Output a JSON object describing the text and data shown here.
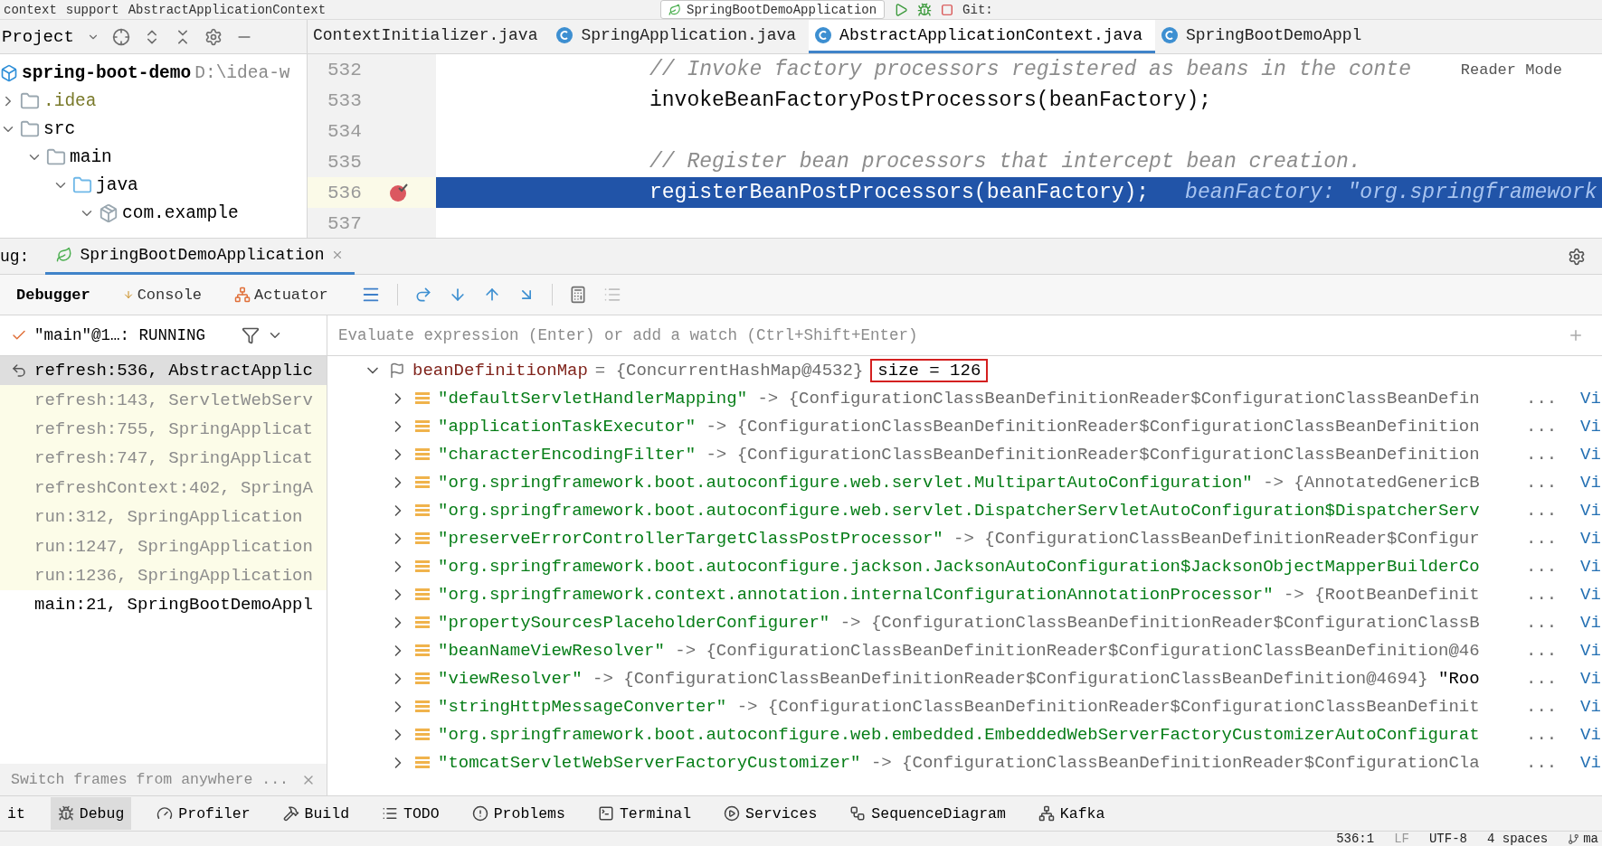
{
  "breadcrumbs": [
    "context",
    "support",
    "AbstractApplicationContext"
  ],
  "run_config": "SpringBootDemoApplication",
  "vcs_label": "Git:",
  "project_panel": {
    "title": "Project",
    "tree": [
      {
        "name": "spring-boot-demo",
        "kind": "module",
        "path": "D:\\idea-w",
        "ignored": false,
        "children": [
          {
            "name": ".idea",
            "kind": "folder",
            "expanded": false,
            "ignored": true
          },
          {
            "name": "src",
            "kind": "folder",
            "expanded": true,
            "ignored": false,
            "children": [
              {
                "name": "main",
                "kind": "folder",
                "expanded": true,
                "ignored": false,
                "children": [
                  {
                    "name": "java",
                    "kind": "source",
                    "expanded": true,
                    "ignored": false,
                    "children": [
                      {
                        "name": "com.example",
                        "kind": "package",
                        "expanded": true,
                        "ignored": false
                      }
                    ]
                  }
                ]
              }
            ]
          }
        ]
      }
    ]
  },
  "editor_tabs": [
    {
      "label": "ContextInitializer.java",
      "selected": false,
      "icon": false
    },
    {
      "label": "SpringApplication.java",
      "selected": false,
      "icon": true
    },
    {
      "label": "AbstractApplicationContext.java",
      "selected": true,
      "icon": true
    },
    {
      "label": "SpringBootDemoAppl",
      "selected": false,
      "icon": true
    }
  ],
  "editor": {
    "reader_mode": "Reader Mode",
    "lines": [
      {
        "number": "532",
        "kind": "comment",
        "text": "// Invoke factory processors registered as beans in the conte",
        "breakpoint": false,
        "current": false
      },
      {
        "number": "533",
        "kind": "code",
        "text": "invokeBeanFactoryPostProcessors(beanFactory);",
        "breakpoint": false,
        "current": false
      },
      {
        "number": "534",
        "kind": "blank",
        "breakpoint": false,
        "current": false
      },
      {
        "number": "535",
        "kind": "comment",
        "text": "// Register bean processors that intercept bean creation.",
        "breakpoint": false,
        "current": false
      },
      {
        "number": "536",
        "kind": "code",
        "text": "registerBeanPostProcessors(beanFactory);",
        "hint": "beanFactory: \"org.springframework",
        "breakpoint": true,
        "current": true
      },
      {
        "number": "537",
        "kind": "blank",
        "breakpoint": false,
        "current": false
      }
    ]
  },
  "debug": {
    "label": "ug:",
    "session_tab": "SpringBootDemoApplication",
    "tabs": [
      {
        "label": "Debugger",
        "selected": true
      },
      {
        "label": "Console",
        "selected": false
      },
      {
        "label": "Actuator",
        "selected": false
      }
    ],
    "thread": "\"main\"@1…: RUNNING",
    "evaluate_placeholder": "Evaluate expression (Enter) or add a watch (Ctrl+Shift+Enter)",
    "frames": [
      {
        "text": "refresh:536, AbstractApplic",
        "kind": "current",
        "selected": true
      },
      {
        "text": "refresh:143, ServletWebServ",
        "kind": "library",
        "selected": false
      },
      {
        "text": "refresh:755, SpringApplicat",
        "kind": "library",
        "selected": false
      },
      {
        "text": "refresh:747, SpringApplicat",
        "kind": "library",
        "selected": false
      },
      {
        "text": "refreshContext:402, SpringA",
        "kind": "library",
        "selected": false
      },
      {
        "text": "run:312, SpringApplication",
        "kind": "library",
        "selected": false
      },
      {
        "text": "run:1247, SpringApplication",
        "kind": "library",
        "selected": false
      },
      {
        "text": "run:1236, SpringApplication",
        "kind": "library",
        "selected": false
      },
      {
        "text": "main:21, SpringBootDemoAppl",
        "kind": "user",
        "selected": false
      }
    ],
    "frames_hint": "Switch frames from anywhere ...",
    "variable": {
      "name": "beanDefinitionMap",
      "value": "= {ConcurrentHashMap@4532}",
      "size": "size = 126",
      "boxed": true,
      "expanded": true,
      "entries": [
        {
          "key": "\"defaultServletHandlerMapping\"",
          "value": "-> {ConfigurationClassBeanDefinitionReader$ConfigurationClassBeanDefin",
          "more": "...",
          "link": "Vi"
        },
        {
          "key": "\"applicationTaskExecutor\"",
          "value": "-> {ConfigurationClassBeanDefinitionReader$ConfigurationClassBeanDefinition",
          "more": "...",
          "link": "Vi"
        },
        {
          "key": "\"characterEncodingFilter\"",
          "value": "-> {ConfigurationClassBeanDefinitionReader$ConfigurationClassBeanDefinition",
          "more": "...",
          "link": "Vi"
        },
        {
          "key": "\"org.springframework.boot.autoconfigure.web.servlet.MultipartAutoConfiguration\"",
          "value": "-> {AnnotatedGenericB",
          "more": "...",
          "link": "Vi"
        },
        {
          "key": "\"org.springframework.boot.autoconfigure.web.servlet.DispatcherServletAutoConfiguration$DispatcherServ",
          "more": "...",
          "link": "Vi"
        },
        {
          "key": "\"preserveErrorControllerTargetClassPostProcessor\"",
          "value": "-> {ConfigurationClassBeanDefinitionReader$Configur",
          "more": "...",
          "link": "Vi"
        },
        {
          "key": "\"org.springframework.boot.autoconfigure.jackson.JacksonAutoConfiguration$JacksonObjectMapperBuilderCo",
          "more": "...",
          "link": "Vi"
        },
        {
          "key": "\"org.springframework.context.annotation.internalConfigurationAnnotationProcessor\"",
          "value": "-> {RootBeanDefinit",
          "more": "...",
          "link": "Vi"
        },
        {
          "key": "\"propertySourcesPlaceholderConfigurer\"",
          "value": "-> {ConfigurationClassBeanDefinitionReader$ConfigurationClassB",
          "more": "...",
          "link": "Vi"
        },
        {
          "key": "\"beanNameViewResolver\"",
          "value": "-> {ConfigurationClassBeanDefinitionReader$ConfigurationClassBeanDefinition@46",
          "more": "...",
          "link": "Vi"
        },
        {
          "key": "\"viewResolver\"",
          "value": "-> {ConfigurationClassBeanDefinitionReader$ConfigurationClassBeanDefinition@4694}",
          "extra": "\"Roo",
          "more": "...",
          "link": "Vi"
        },
        {
          "key": "\"stringHttpMessageConverter\"",
          "value": "-> {ConfigurationClassBeanDefinitionReader$ConfigurationClassBeanDefinit",
          "more": "...",
          "link": "Vi"
        },
        {
          "key": "\"org.springframework.boot.autoconfigure.web.embedded.EmbeddedWebServerFactoryCustomizerAutoConfigurat",
          "more": "...",
          "link": "Vi"
        },
        {
          "key": "\"tomcatServletWebServerFactoryCustomizer\"",
          "value": "-> {ConfigurationClassBeanDefinitionReader$ConfigurationCla",
          "more": "...",
          "link": "Vi"
        }
      ]
    }
  },
  "tool_windows": [
    {
      "label": "it",
      "selected": false
    },
    {
      "label": "Debug",
      "selected": true
    },
    {
      "label": "Profiler",
      "selected": false
    },
    {
      "label": "Build",
      "selected": false
    },
    {
      "label": "TODO",
      "selected": false
    },
    {
      "label": "Problems",
      "selected": false
    },
    {
      "label": "Terminal",
      "selected": false
    },
    {
      "label": "Services",
      "selected": false
    },
    {
      "label": "SequenceDiagram",
      "selected": false
    },
    {
      "label": "Kafka",
      "selected": false
    }
  ],
  "status_bar": {
    "position": "536:1",
    "line_separator": "LF",
    "encoding": "UTF-8",
    "indent": "4 spaces",
    "branch": "ma"
  }
}
